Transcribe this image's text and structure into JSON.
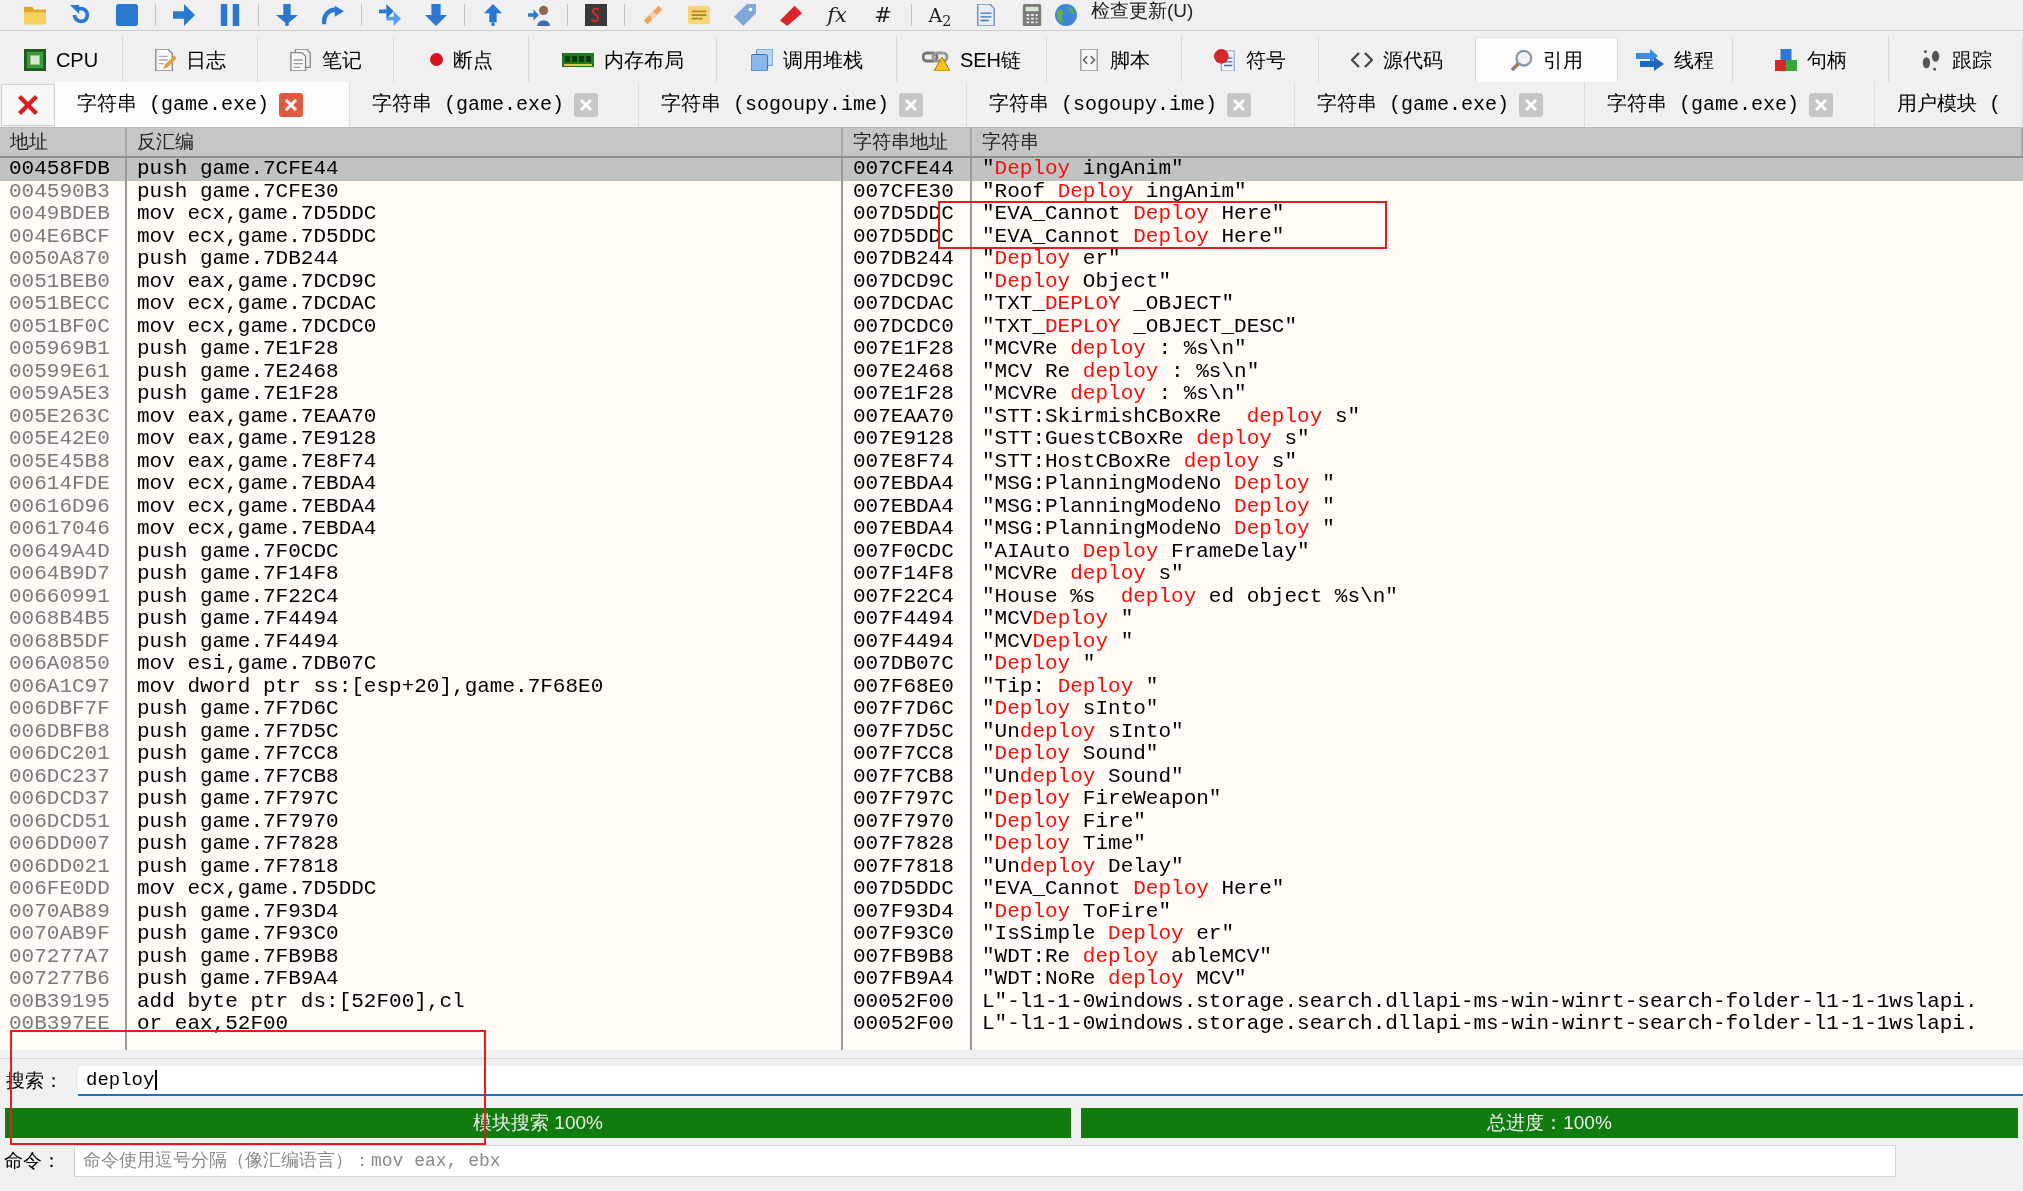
{
  "toolbar": {
    "glyph_buttons": [
      "fx",
      "#",
      "A$_{2}$"
    ],
    "update_menu": "检查更新(U)"
  },
  "main_tabs": [
    {
      "label": "CPU",
      "selected": false
    },
    {
      "label": "日志",
      "selected": false
    },
    {
      "label": "笔记",
      "selected": false
    },
    {
      "label": "断点",
      "selected": false
    },
    {
      "label": "内存布局",
      "selected": false
    },
    {
      "label": "调用堆栈",
      "selected": false
    },
    {
      "label": "SEH链",
      "selected": false
    },
    {
      "label": "脚本",
      "selected": false
    },
    {
      "label": "符号",
      "selected": false
    },
    {
      "label": "源代码",
      "selected": false
    },
    {
      "label": "引用",
      "selected": true
    },
    {
      "label": "线程",
      "selected": false
    },
    {
      "label": "句柄",
      "selected": false
    },
    {
      "label": "跟踪",
      "selected": false
    }
  ],
  "string_tabs": [
    {
      "label": "字符串 (game.exe)",
      "selected": true,
      "closable": true
    },
    {
      "label": "字符串 (game.exe)",
      "selected": false,
      "closable": true
    },
    {
      "label": "字符串 (sogoupy.ime)",
      "selected": false,
      "closable": true
    },
    {
      "label": "字符串 (sogoupy.ime)",
      "selected": false,
      "closable": true
    },
    {
      "label": "字符串 (game.exe)",
      "selected": false,
      "closable": true
    },
    {
      "label": "字符串 (game.exe)",
      "selected": false,
      "closable": true
    },
    {
      "label": "用户模块 (",
      "selected": false,
      "closable": false
    }
  ],
  "table": {
    "columns": [
      "地址",
      "反汇编",
      "字符串地址",
      "字符串"
    ],
    "rows": [
      {
        "address": "00458FDB",
        "disassembly": "push game.7CFE44",
        "string_address": "007CFE44",
        "selected": true,
        "string_parts": [
          {
            "text": "\"",
            "match": false
          },
          {
            "text": "Deploy",
            "match": true
          },
          {
            "text": " ingAnim\"",
            "match": false
          }
        ]
      },
      {
        "address": "004590B3",
        "disassembly": "push game.7CFE30",
        "string_address": "007CFE30",
        "selected": false,
        "string_parts": [
          {
            "text": "\"Roof ",
            "match": false
          },
          {
            "text": "Deploy",
            "match": true
          },
          {
            "text": " ingAnim\"",
            "match": false
          }
        ]
      },
      {
        "address": "0049BDEB",
        "disassembly": "mov ecx,game.7D5DDC",
        "string_address": "007D5DDC",
        "selected": false,
        "string_parts": [
          {
            "text": "\"EVA_Cannot ",
            "match": false
          },
          {
            "text": "Deploy",
            "match": true
          },
          {
            "text": " Here\"",
            "match": false
          }
        ]
      },
      {
        "address": "004E6BCF",
        "disassembly": "mov ecx,game.7D5DDC",
        "string_address": "007D5DDC",
        "selected": false,
        "string_parts": [
          {
            "text": "\"EVA_Cannot ",
            "match": false
          },
          {
            "text": "Deploy",
            "match": true
          },
          {
            "text": " Here\"",
            "match": false
          }
        ]
      },
      {
        "address": "0050A870",
        "disassembly": "push game.7DB244",
        "string_address": "007DB244",
        "selected": false,
        "string_parts": [
          {
            "text": "\"",
            "match": false
          },
          {
            "text": "Deploy",
            "match": true
          },
          {
            "text": " er\"",
            "match": false
          }
        ]
      },
      {
        "address": "0051BEB0",
        "disassembly": "mov eax,game.7DCD9C",
        "string_address": "007DCD9C",
        "selected": false,
        "string_parts": [
          {
            "text": "\"",
            "match": false
          },
          {
            "text": "Deploy",
            "match": true
          },
          {
            "text": " Object\"",
            "match": false
          }
        ]
      },
      {
        "address": "0051BECC",
        "disassembly": "mov ecx,game.7DCDAC",
        "string_address": "007DCDAC",
        "selected": false,
        "string_parts": [
          {
            "text": "\"TXT_",
            "match": false
          },
          {
            "text": "DEPLOY",
            "match": true
          },
          {
            "text": " _OBJECT\"",
            "match": false
          }
        ]
      },
      {
        "address": "0051BF0C",
        "disassembly": "mov ecx,game.7DCDC0",
        "string_address": "007DCDC0",
        "selected": false,
        "string_parts": [
          {
            "text": "\"TXT_",
            "match": false
          },
          {
            "text": "DEPLOY",
            "match": true
          },
          {
            "text": " _OBJECT_DESC\"",
            "match": false
          }
        ]
      },
      {
        "address": "005969B1",
        "disassembly": "push game.7E1F28",
        "string_address": "007E1F28",
        "selected": false,
        "string_parts": [
          {
            "text": "\"MCVRe ",
            "match": false
          },
          {
            "text": "deploy",
            "match": true
          },
          {
            "text": " : %s\\n\"",
            "match": false
          }
        ]
      },
      {
        "address": "00599E61",
        "disassembly": "push game.7E2468",
        "string_address": "007E2468",
        "selected": false,
        "string_parts": [
          {
            "text": "\"MCV Re ",
            "match": false
          },
          {
            "text": "deploy",
            "match": true
          },
          {
            "text": " : %s\\n\"",
            "match": false
          }
        ]
      },
      {
        "address": "0059A5E3",
        "disassembly": "push game.7E1F28",
        "string_address": "007E1F28",
        "selected": false,
        "string_parts": [
          {
            "text": "\"MCVRe ",
            "match": false
          },
          {
            "text": "deploy",
            "match": true
          },
          {
            "text": " : %s\\n\"",
            "match": false
          }
        ]
      },
      {
        "address": "005E263C",
        "disassembly": "mov eax,game.7EAA70",
        "string_address": "007EAA70",
        "selected": false,
        "string_parts": [
          {
            "text": "\"STT:SkirmishCBoxRe  ",
            "match": false
          },
          {
            "text": "deploy",
            "match": true
          },
          {
            "text": " s\"",
            "match": false
          }
        ]
      },
      {
        "address": "005E42E0",
        "disassembly": "mov eax,game.7E9128",
        "string_address": "007E9128",
        "selected": false,
        "string_parts": [
          {
            "text": "\"STT:GuestCBoxRe ",
            "match": false
          },
          {
            "text": "deploy",
            "match": true
          },
          {
            "text": " s\"",
            "match": false
          }
        ]
      },
      {
        "address": "005E45B8",
        "disassembly": "mov eax,game.7E8F74",
        "string_address": "007E8F74",
        "selected": false,
        "string_parts": [
          {
            "text": "\"STT:HostCBoxRe ",
            "match": false
          },
          {
            "text": "deploy",
            "match": true
          },
          {
            "text": " s\"",
            "match": false
          }
        ]
      },
      {
        "address": "00614FDE",
        "disassembly": "mov ecx,game.7EBDA4",
        "string_address": "007EBDA4",
        "selected": false,
        "string_parts": [
          {
            "text": "\"MSG:PlanningModeNo ",
            "match": false
          },
          {
            "text": "Deploy",
            "match": true
          },
          {
            "text": " \"",
            "match": false
          }
        ]
      },
      {
        "address": "00616D96",
        "disassembly": "mov ecx,game.7EBDA4",
        "string_address": "007EBDA4",
        "selected": false,
        "string_parts": [
          {
            "text": "\"MSG:PlanningModeNo ",
            "match": false
          },
          {
            "text": "Deploy",
            "match": true
          },
          {
            "text": " \"",
            "match": false
          }
        ]
      },
      {
        "address": "00617046",
        "disassembly": "mov ecx,game.7EBDA4",
        "string_address": "007EBDA4",
        "selected": false,
        "string_parts": [
          {
            "text": "\"MSG:PlanningModeNo ",
            "match": false
          },
          {
            "text": "Deploy",
            "match": true
          },
          {
            "text": " \"",
            "match": false
          }
        ]
      },
      {
        "address": "00649A4D",
        "disassembly": "push game.7F0CDC",
        "string_address": "007F0CDC",
        "selected": false,
        "string_parts": [
          {
            "text": "\"AIAuto ",
            "match": false
          },
          {
            "text": "Deploy",
            "match": true
          },
          {
            "text": " FrameDelay\"",
            "match": false
          }
        ]
      },
      {
        "address": "0064B9D7",
        "disassembly": "push game.7F14F8",
        "string_address": "007F14F8",
        "selected": false,
        "string_parts": [
          {
            "text": "\"MCVRe ",
            "match": false
          },
          {
            "text": "deploy",
            "match": true
          },
          {
            "text": " s\"",
            "match": false
          }
        ]
      },
      {
        "address": "00660991",
        "disassembly": "push game.7F22C4",
        "string_address": "007F22C4",
        "selected": false,
        "string_parts": [
          {
            "text": "\"House %s  ",
            "match": false
          },
          {
            "text": "deploy",
            "match": true
          },
          {
            "text": " ed object %s\\n\"",
            "match": false
          }
        ]
      },
      {
        "address": "0068B4B5",
        "disassembly": "push game.7F4494",
        "string_address": "007F4494",
        "selected": false,
        "string_parts": [
          {
            "text": "\"MCV",
            "match": false
          },
          {
            "text": "Deploy",
            "match": true
          },
          {
            "text": " \"",
            "match": false
          }
        ]
      },
      {
        "address": "0068B5DF",
        "disassembly": "push game.7F4494",
        "string_address": "007F4494",
        "selected": false,
        "string_parts": [
          {
            "text": "\"MCV",
            "match": false
          },
          {
            "text": "Deploy",
            "match": true
          },
          {
            "text": " \"",
            "match": false
          }
        ]
      },
      {
        "address": "006A0850",
        "disassembly": "mov esi,game.7DB07C",
        "string_address": "007DB07C",
        "selected": false,
        "string_parts": [
          {
            "text": "\"",
            "match": false
          },
          {
            "text": "Deploy",
            "match": true
          },
          {
            "text": " \"",
            "match": false
          }
        ]
      },
      {
        "address": "006A1C97",
        "disassembly": "mov dword ptr ss:[esp+20],game.7F68E0",
        "string_address": "007F68E0",
        "selected": false,
        "string_parts": [
          {
            "text": "\"Tip: ",
            "match": false
          },
          {
            "text": "Deploy",
            "match": true
          },
          {
            "text": " \"",
            "match": false
          }
        ]
      },
      {
        "address": "006DBF7F",
        "disassembly": "push game.7F7D6C",
        "string_address": "007F7D6C",
        "selected": false,
        "string_parts": [
          {
            "text": "\"",
            "match": false
          },
          {
            "text": "Deploy",
            "match": true
          },
          {
            "text": " sInto\"",
            "match": false
          }
        ]
      },
      {
        "address": "006DBFB8",
        "disassembly": "push game.7F7D5C",
        "string_address": "007F7D5C",
        "selected": false,
        "string_parts": [
          {
            "text": "\"Un",
            "match": false
          },
          {
            "text": "deploy",
            "match": true
          },
          {
            "text": " sInto\"",
            "match": false
          }
        ]
      },
      {
        "address": "006DC201",
        "disassembly": "push game.7F7CC8",
        "string_address": "007F7CC8",
        "selected": false,
        "string_parts": [
          {
            "text": "\"",
            "match": false
          },
          {
            "text": "Deploy",
            "match": true
          },
          {
            "text": " Sound\"",
            "match": false
          }
        ]
      },
      {
        "address": "006DC237",
        "disassembly": "push game.7F7CB8",
        "string_address": "007F7CB8",
        "selected": false,
        "string_parts": [
          {
            "text": "\"Un",
            "match": false
          },
          {
            "text": "deploy",
            "match": true
          },
          {
            "text": " Sound\"",
            "match": false
          }
        ]
      },
      {
        "address": "006DCD37",
        "disassembly": "push game.7F797C",
        "string_address": "007F797C",
        "selected": false,
        "string_parts": [
          {
            "text": "\"",
            "match": false
          },
          {
            "text": "Deploy",
            "match": true
          },
          {
            "text": " FireWeapon\"",
            "match": false
          }
        ]
      },
      {
        "address": "006DCD51",
        "disassembly": "push game.7F7970",
        "string_address": "007F7970",
        "selected": false,
        "string_parts": [
          {
            "text": "\"",
            "match": false
          },
          {
            "text": "Deploy",
            "match": true
          },
          {
            "text": " Fire\"",
            "match": false
          }
        ]
      },
      {
        "address": "006DD007",
        "disassembly": "push game.7F7828",
        "string_address": "007F7828",
        "selected": false,
        "string_parts": [
          {
            "text": "\"",
            "match": false
          },
          {
            "text": "Deploy",
            "match": true
          },
          {
            "text": " Time\"",
            "match": false
          }
        ]
      },
      {
        "address": "006DD021",
        "disassembly": "push game.7F7818",
        "string_address": "007F7818",
        "selected": false,
        "string_parts": [
          {
            "text": "\"Un",
            "match": false
          },
          {
            "text": "deploy",
            "match": true
          },
          {
            "text": " Delay\"",
            "match": false
          }
        ]
      },
      {
        "address": "006FE0DD",
        "disassembly": "mov ecx,game.7D5DDC",
        "string_address": "007D5DDC",
        "selected": false,
        "string_parts": [
          {
            "text": "\"EVA_Cannot ",
            "match": false
          },
          {
            "text": "Deploy",
            "match": true
          },
          {
            "text": " Here\"",
            "match": false
          }
        ]
      },
      {
        "address": "0070AB89",
        "disassembly": "push game.7F93D4",
        "string_address": "007F93D4",
        "selected": false,
        "string_parts": [
          {
            "text": "\"",
            "match": false
          },
          {
            "text": "Deploy",
            "match": true
          },
          {
            "text": " ToFire\"",
            "match": false
          }
        ]
      },
      {
        "address": "0070AB9F",
        "disassembly": "push game.7F93C0",
        "string_address": "007F93C0",
        "selected": false,
        "string_parts": [
          {
            "text": "\"IsSimple ",
            "match": false
          },
          {
            "text": "Deploy",
            "match": true
          },
          {
            "text": " er\"",
            "match": false
          }
        ]
      },
      {
        "address": "007277A7",
        "disassembly": "push game.7FB9B8",
        "string_address": "007FB9B8",
        "selected": false,
        "string_parts": [
          {
            "text": "\"WDT:Re ",
            "match": false
          },
          {
            "text": "deploy",
            "match": true
          },
          {
            "text": " ableMCV\"",
            "match": false
          }
        ]
      },
      {
        "address": "007277B6",
        "disassembly": "push game.7FB9A4",
        "string_address": "007FB9A4",
        "selected": false,
        "string_parts": [
          {
            "text": "\"WDT:NoRe ",
            "match": false
          },
          {
            "text": "deploy",
            "match": true
          },
          {
            "text": " MCV\"",
            "match": false
          }
        ]
      },
      {
        "address": "00B39195",
        "disassembly": "add byte ptr ds:[52F00],cl",
        "string_address": "00052F00",
        "selected": false,
        "string_parts": [
          {
            "text": "L\"-l1-1-0windows.storage.search.dllapi-ms-win-winrt-search-folder-l1-1-1wslapi.",
            "match": false
          }
        ]
      },
      {
        "address": "00B397EE",
        "disassembly": "or eax,52F00",
        "string_address": "00052F00",
        "selected": false,
        "string_parts": [
          {
            "text": "L\"-l1-1-0windows.storage.search.dllapi-ms-win-winrt-search-folder-l1-1-1wslapi.",
            "match": false
          }
        ]
      }
    ]
  },
  "search": {
    "label": "搜索：",
    "value": "deploy"
  },
  "progress": [
    {
      "label": "模块搜索 100%",
      "level": 1
    },
    {
      "label": "总进度：100%",
      "level": 1
    }
  ],
  "command": {
    "label": "命令：",
    "placeholder": "命令使用逗号分隔（像汇编语言）：mov eax, ebx"
  }
}
